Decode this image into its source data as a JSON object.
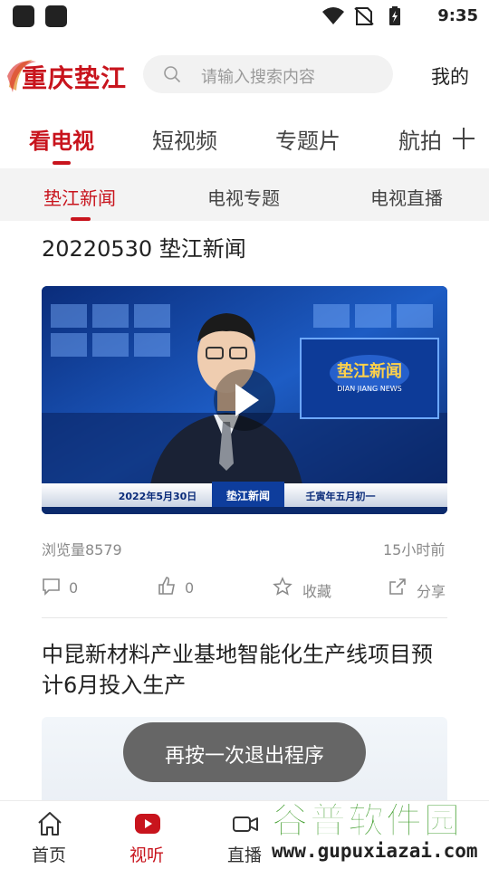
{
  "status_bar": {
    "time": "9:35"
  },
  "header": {
    "logo_text": "重庆垫江",
    "search_placeholder": "请输入搜索内容",
    "mine_label": "我的"
  },
  "top_tabs": [
    {
      "label": "看电视",
      "active": true
    },
    {
      "label": "短视频",
      "active": false
    },
    {
      "label": "专题片",
      "active": false
    },
    {
      "label": "航拍",
      "active": false
    }
  ],
  "sub_tabs": [
    {
      "label": "垫江新闻",
      "active": true
    },
    {
      "label": "电视专题",
      "active": false
    },
    {
      "label": "电视直播",
      "active": false
    }
  ],
  "articles": [
    {
      "title": "20220530 垫江新闻",
      "video": {
        "brand_text": "垫江新闻",
        "brand_sub": "DIAN JIANG NEWS",
        "ticker_date": "2022年5月30日",
        "ticker_program": "垫江新闻",
        "ticker_lunar": "壬寅年五月初一"
      },
      "views": "浏览量8579",
      "time_ago": "15小时前",
      "comment_count": "0",
      "like_count": "0",
      "favorite_label": "收藏",
      "share_label": "分享"
    },
    {
      "title": "中昆新材料产业基地智能化生产线项目预计6月投入生产"
    }
  ],
  "toast": {
    "text": "再按一次退出程序"
  },
  "bottom_nav": [
    {
      "label": "首页",
      "icon": "home-icon",
      "active": false
    },
    {
      "label": "视听",
      "icon": "play-video-icon",
      "active": true
    },
    {
      "label": "直播",
      "icon": "camera-icon",
      "active": false
    }
  ],
  "watermark": {
    "title": "谷普软件园",
    "url": "www.gupuxiazai.com"
  },
  "colors": {
    "accent": "#c8141d",
    "toast_bg": "#666666",
    "subtab_bg": "#f3f3f3",
    "watermark_green": "#3a9a26"
  }
}
